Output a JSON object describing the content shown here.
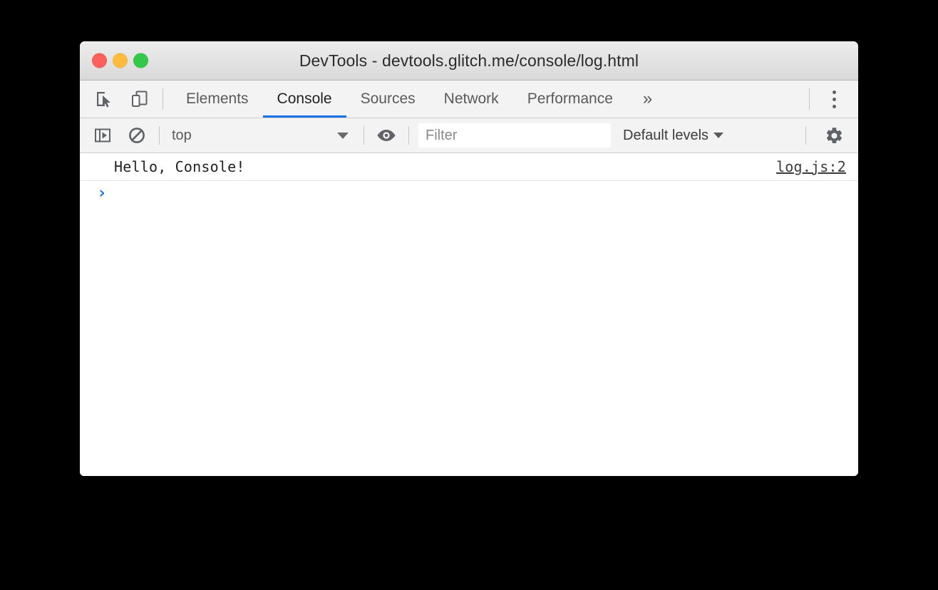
{
  "window": {
    "title": "DevTools - devtools.glitch.me/console/log.html",
    "traffic_lights": {
      "close_color": "#fc6058",
      "minimize_color": "#fdbc40",
      "maximize_color": "#34c749"
    }
  },
  "tabbar": {
    "icons": [
      {
        "name": "inspect-element-icon"
      },
      {
        "name": "device-toolbar-icon"
      }
    ],
    "tabs": [
      {
        "label": "Elements",
        "active": false
      },
      {
        "label": "Console",
        "active": true
      },
      {
        "label": "Sources",
        "active": false
      },
      {
        "label": "Network",
        "active": false
      },
      {
        "label": "Performance",
        "active": false
      }
    ],
    "more_tabs_label": "»",
    "active_tab": "Console",
    "active_underline_color": "#1a73e8",
    "main_menu_label": "Customize and control DevTools"
  },
  "console_toolbar": {
    "sidebar_toggle_label": "Show console sidebar",
    "clear_console_label": "Clear console",
    "context": {
      "selected": "top",
      "options": [
        "top"
      ]
    },
    "live_expression_label": "Create live expression",
    "filter": {
      "value": "",
      "placeholder": "Filter"
    },
    "levels": {
      "selected": "Default levels",
      "caret": "▼"
    },
    "settings_label": "Console settings"
  },
  "console": {
    "messages": [
      {
        "text": "Hello, Console!",
        "source": "log.js:2"
      }
    ],
    "prompt": {
      "arrow": "›",
      "value": ""
    }
  },
  "colors": {
    "accent": "#1a73e8",
    "toolbar_bg": "#f3f3f3",
    "titlebar_bg": "#e4e4e4",
    "border": "#cdcdcd",
    "text": "#5a5a5a",
    "desktop_bg": "#000000"
  }
}
